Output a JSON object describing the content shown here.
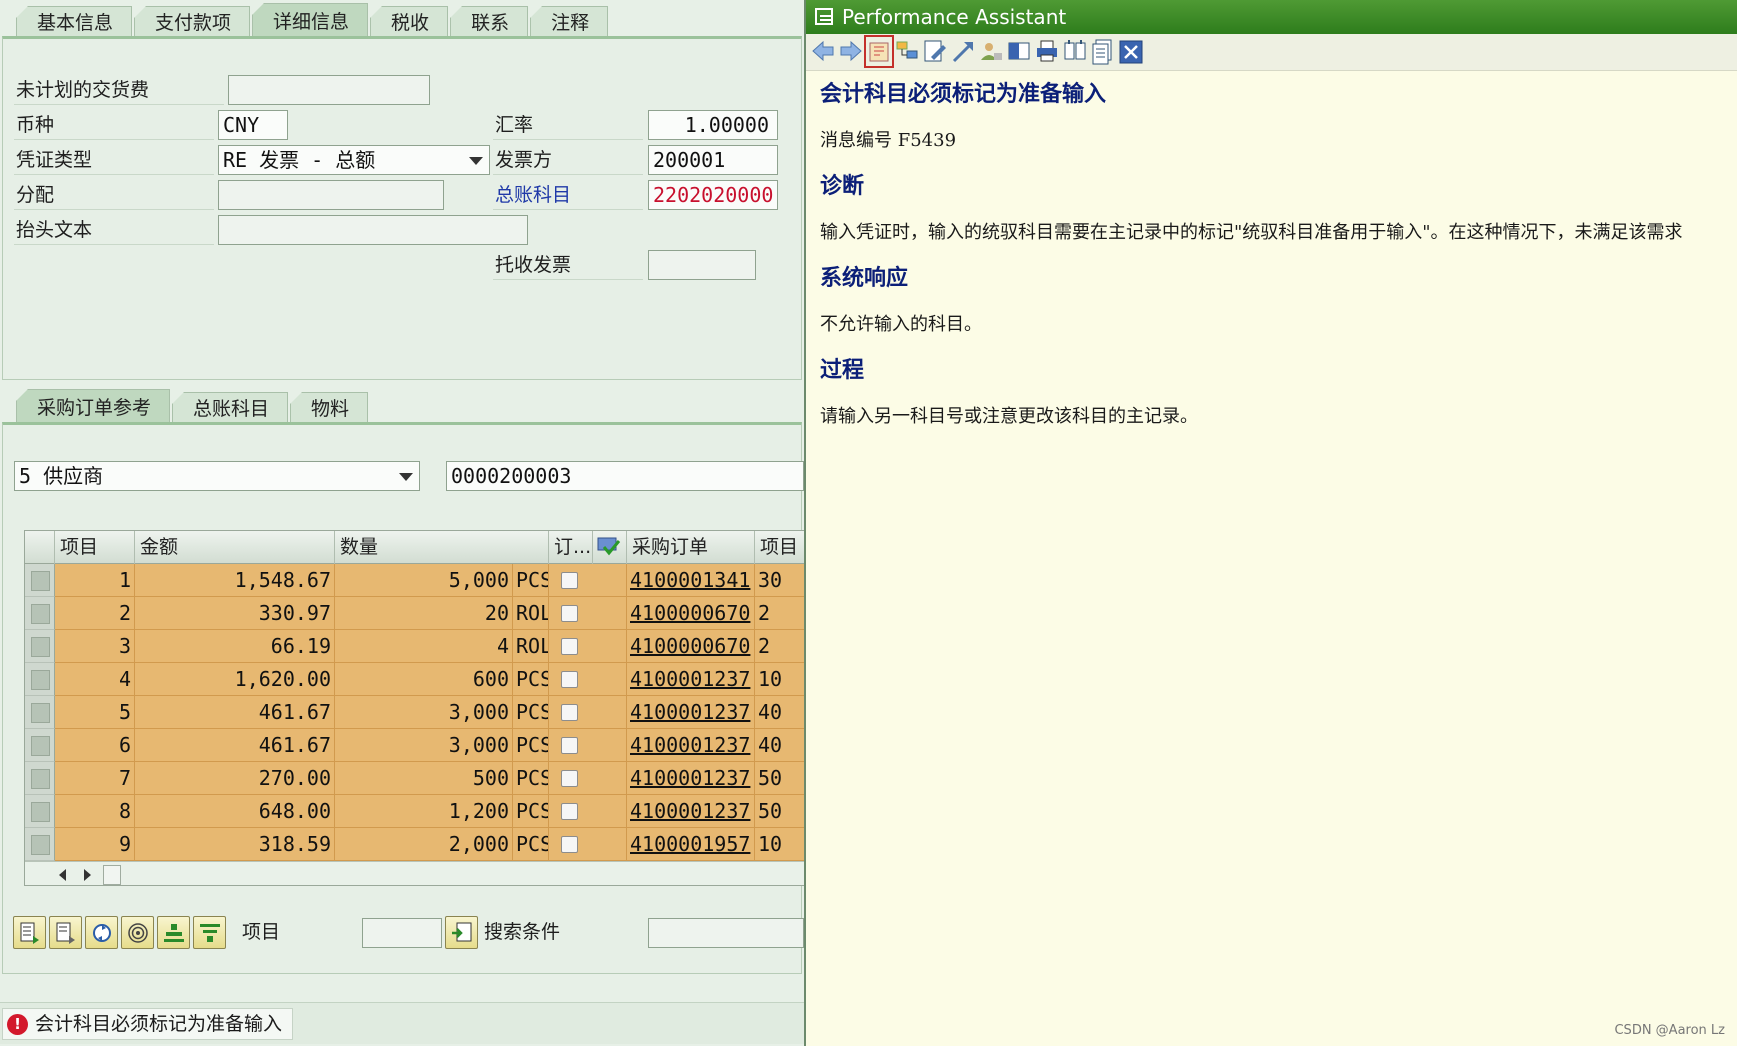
{
  "header_tabs": [
    "基本信息",
    "支付款项",
    "详细信息",
    "税收",
    "联系",
    "注释"
  ],
  "details": {
    "unplanned_delivery_label": "未计划的交货费",
    "unplanned_delivery_value": "",
    "currency_label": "币种",
    "currency_value": "CNY",
    "exchange_rate_label": "汇率",
    "exchange_rate_value": "1.00000",
    "doc_type_label": "凭证类型",
    "doc_type_value": "RE 发票 - 总额",
    "invoicing_party_label": "发票方",
    "invoicing_party_value": "200001",
    "assignment_label": "分配",
    "assignment_value": "",
    "gl_account_label": "总账科目",
    "gl_account_value": "2202020000",
    "header_text_label": "抬头文本",
    "header_text_value": "",
    "collection_invoice_label": "托收发票",
    "collection_invoice_value": ""
  },
  "lower_tabs": [
    "采购订单参考",
    "总账科目",
    "物料"
  ],
  "reference": {
    "type_value": "5 供应商",
    "vendor_value": "0000200003"
  },
  "grid": {
    "columns": [
      "项目",
      "金额",
      "数量",
      "订...",
      "",
      "采购订单",
      "项目"
    ],
    "rows": [
      {
        "item": "1",
        "amount": "1,548.67",
        "qty": "5,000",
        "unit": "PCS",
        "po": "4100001341",
        "po_item": "30"
      },
      {
        "item": "2",
        "amount": "330.97",
        "qty": "20",
        "unit": "ROL",
        "po": "4100000670",
        "po_item": "2"
      },
      {
        "item": "3",
        "amount": "66.19",
        "qty": "4",
        "unit": "ROL",
        "po": "4100000670",
        "po_item": "2"
      },
      {
        "item": "4",
        "amount": "1,620.00",
        "qty": "600",
        "unit": "PCS",
        "po": "4100001237",
        "po_item": "10"
      },
      {
        "item": "5",
        "amount": "461.67",
        "qty": "3,000",
        "unit": "PCS",
        "po": "4100001237",
        "po_item": "40"
      },
      {
        "item": "6",
        "amount": "461.67",
        "qty": "3,000",
        "unit": "PCS",
        "po": "4100001237",
        "po_item": "40"
      },
      {
        "item": "7",
        "amount": "270.00",
        "qty": "500",
        "unit": "PCS",
        "po": "4100001237",
        "po_item": "50"
      },
      {
        "item": "8",
        "amount": "648.00",
        "qty": "1,200",
        "unit": "PCS",
        "po": "4100001237",
        "po_item": "50"
      },
      {
        "item": "9",
        "amount": "318.59",
        "qty": "2,000",
        "unit": "PCS",
        "po": "4100001957",
        "po_item": "10"
      }
    ]
  },
  "bottom": {
    "item_label": "项目",
    "item_value": "",
    "search_label": "搜索条件",
    "search_value": ""
  },
  "status_message": "会计科目必须标记为准备输入",
  "assistant": {
    "title": "Performance Assistant",
    "heading": "会计科目必须标记为准备输入",
    "message_no": "消息编号 F5439",
    "diagnosis_title": "诊断",
    "diagnosis_text": "输入凭证时，输入的统驭科目需要在主记录中的标记\"统驭科目准备用于输入\"。在这种情况下，未满足该需求",
    "response_title": "系统响应",
    "response_text": "不允许输入的科目。",
    "procedure_title": "过程",
    "procedure_text": "请输入另一科目号或注意更改该科目的主记录。"
  },
  "watermark": "CSDN @Aaron Lz"
}
